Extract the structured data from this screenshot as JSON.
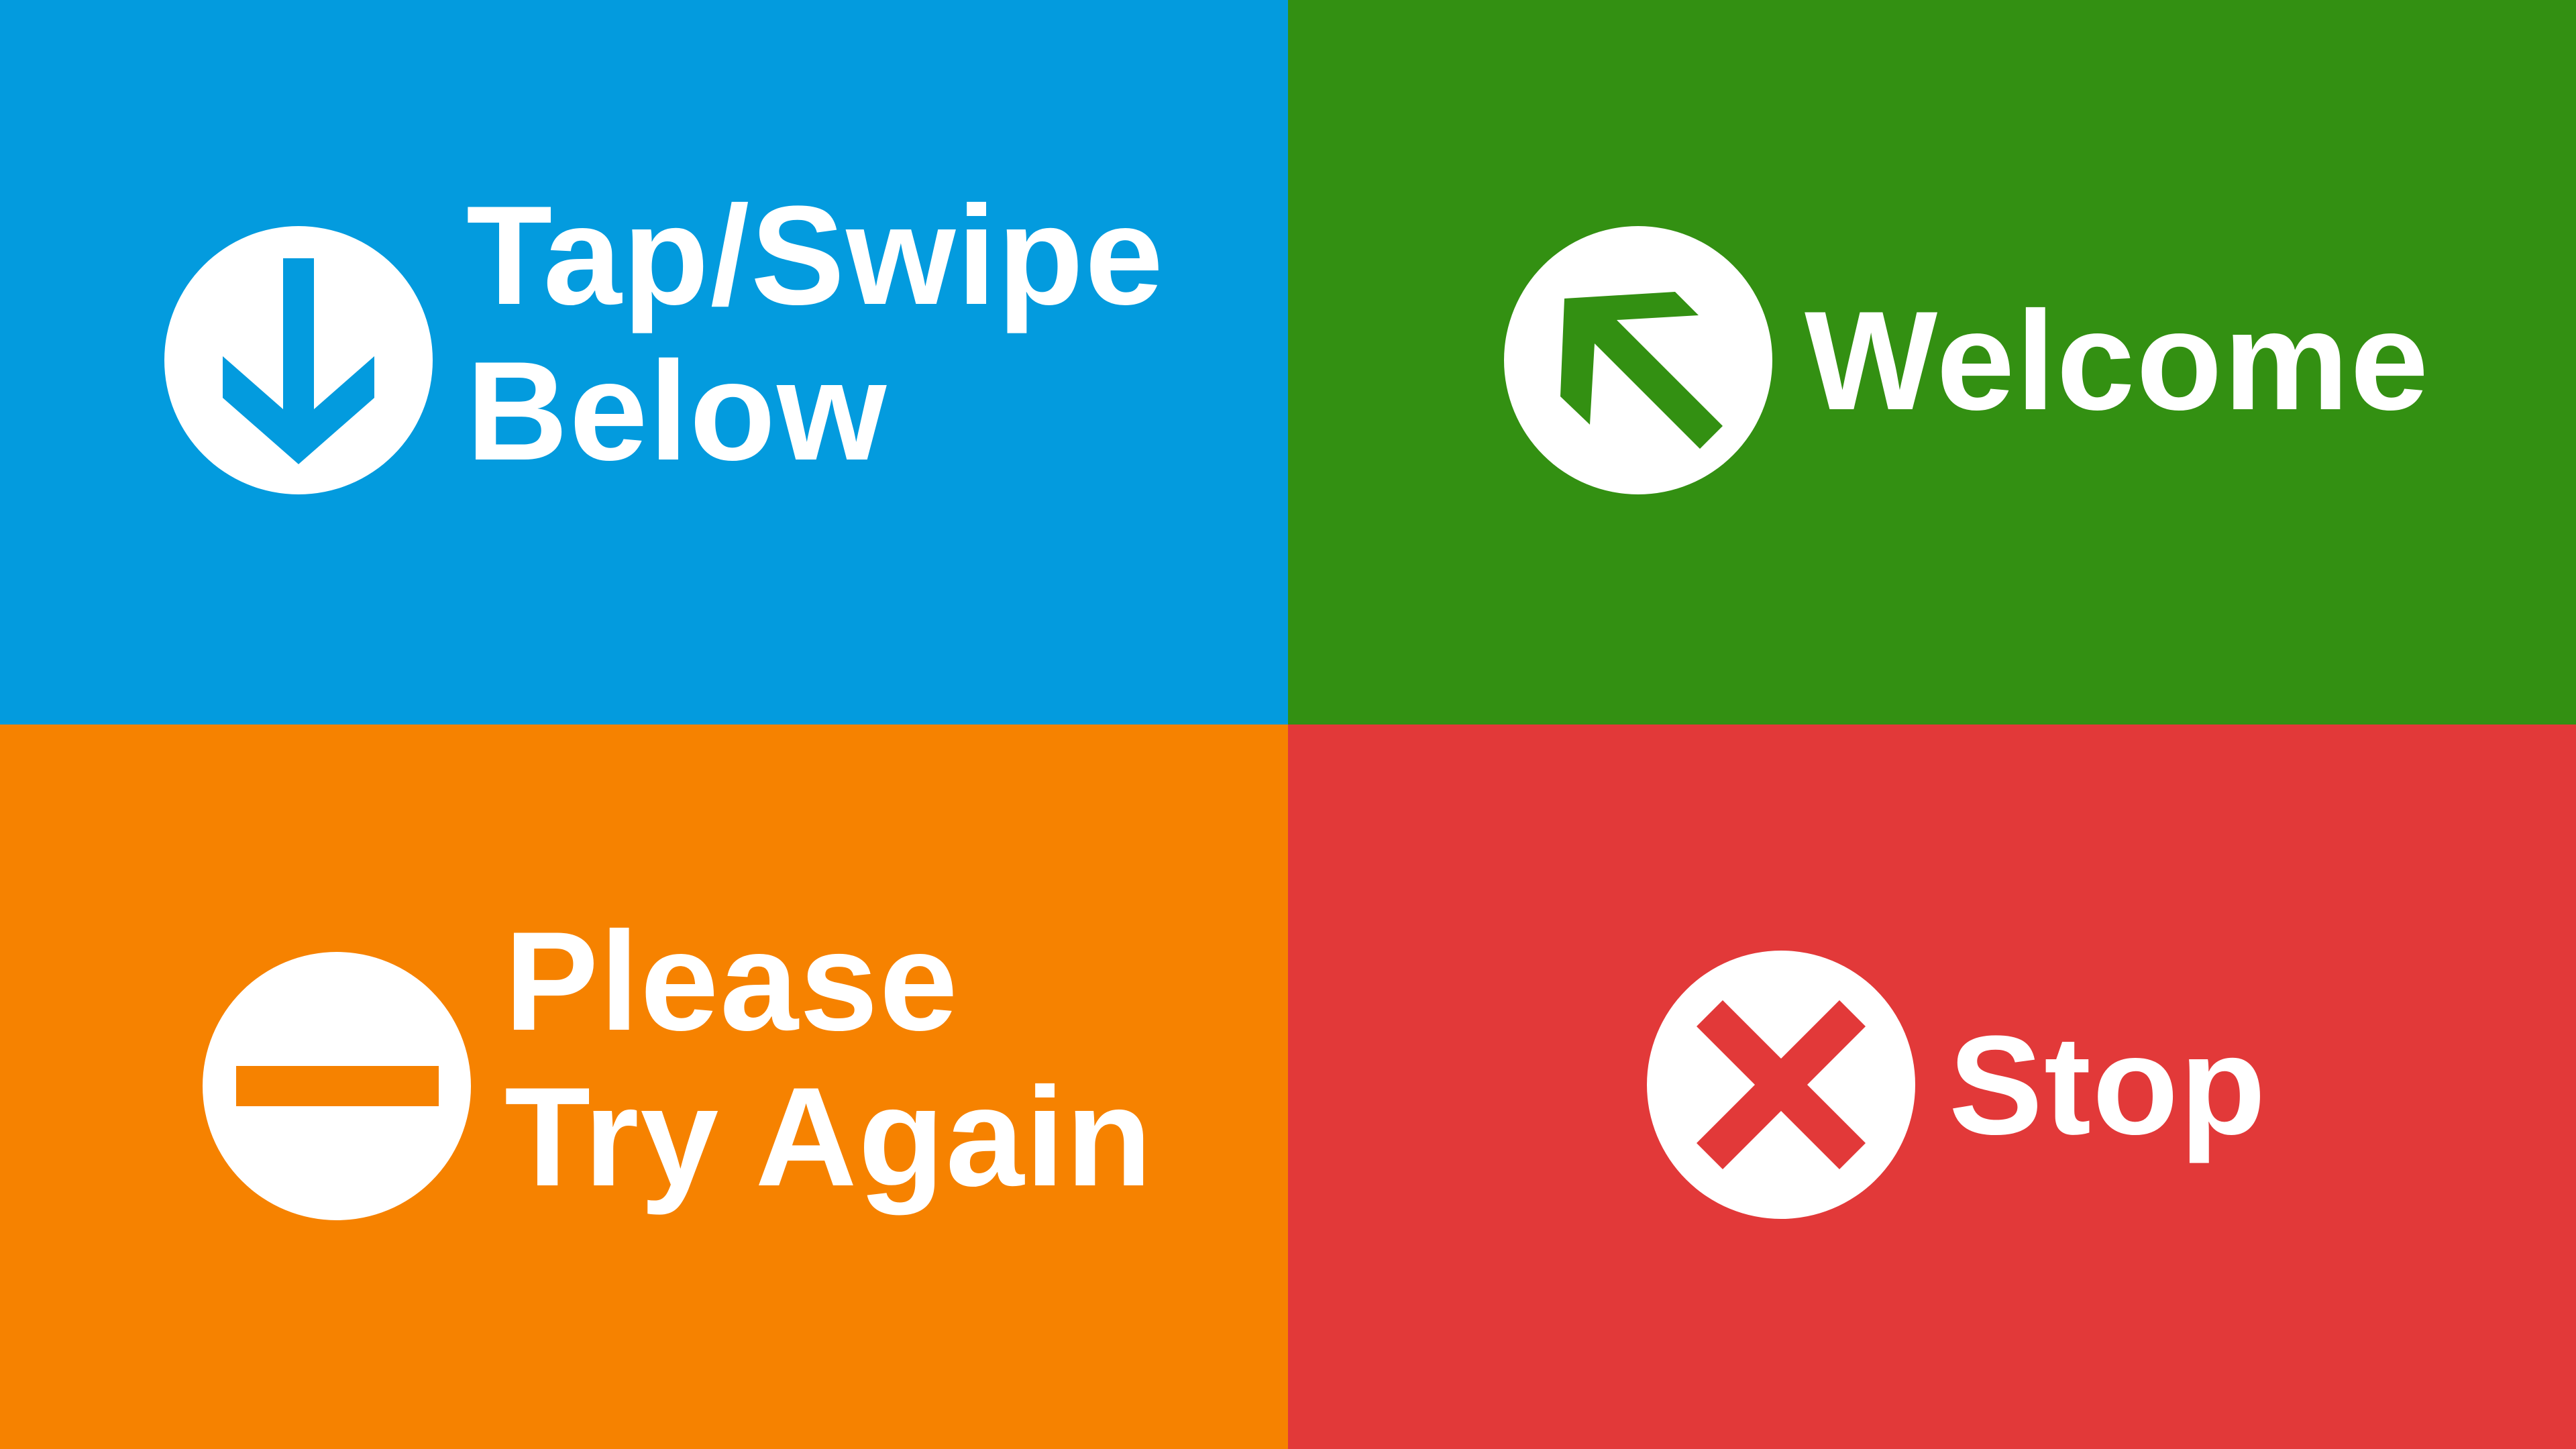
{
  "tiles": {
    "tap_swipe": {
      "color": "#039BDE",
      "icon": "arrow-down-circle-icon",
      "line1": "Tap/Swipe",
      "line2": "Below"
    },
    "welcome": {
      "color": "#339012",
      "icon": "arrow-up-left-circle-icon",
      "line1": "Welcome"
    },
    "try_again": {
      "color": "#F68200",
      "icon": "minus-circle-icon",
      "line1": "Please",
      "line2": "Try Again"
    },
    "stop": {
      "color": "#E23939",
      "icon": "x-circle-icon",
      "line1": "Stop"
    }
  }
}
